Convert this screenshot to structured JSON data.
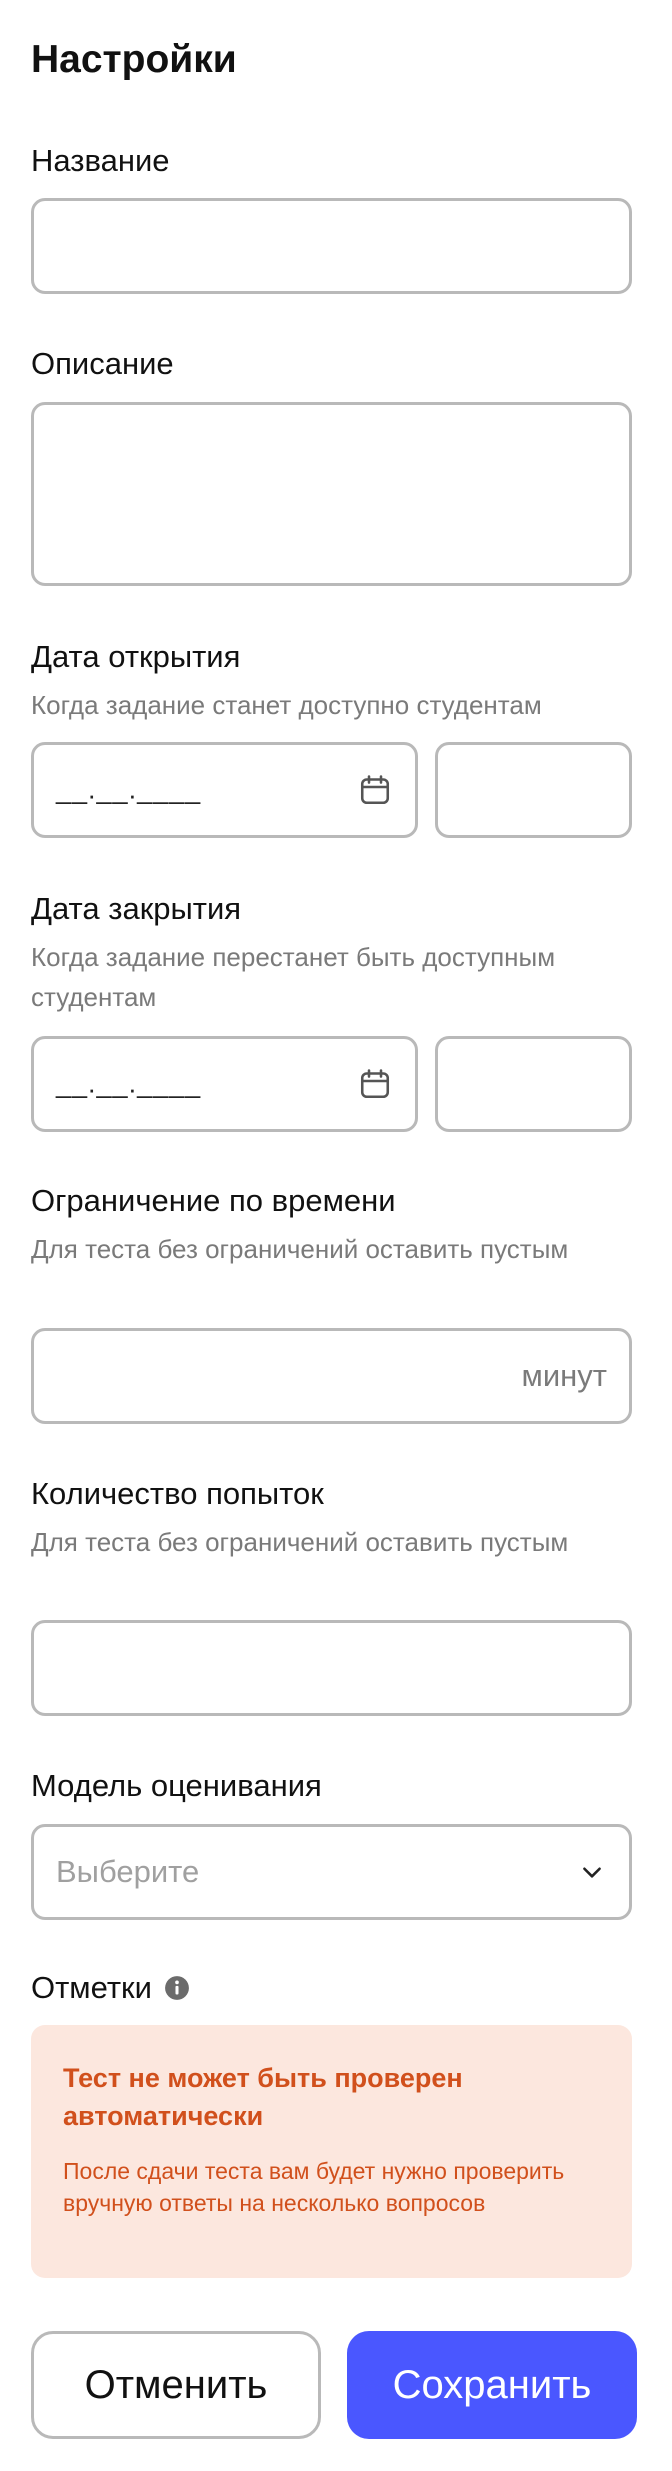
{
  "page": {
    "title": "Настройки"
  },
  "name_field": {
    "label": "Название",
    "value": "",
    "placeholder": ""
  },
  "description_field": {
    "label": "Описание",
    "value": "",
    "placeholder": ""
  },
  "open_date": {
    "label": "Дата открытия",
    "hint": "Когда задание станет доступно студентам",
    "date_mask": "__.__.____",
    "icon": "calendar-icon",
    "time_value": ""
  },
  "close_date": {
    "label": "Дата закрытия",
    "hint": "Когда задание перестанет быть доступным студентам",
    "date_mask": "__.__.____",
    "icon": "calendar-icon",
    "time_value": ""
  },
  "time_limit": {
    "label": "Ограничение по времени",
    "hint": "Для теста без ограничений оставить пустым",
    "suffix": "минут",
    "value": ""
  },
  "attempts": {
    "label": "Количество попыток",
    "hint": "Для теста без ограничений оставить пустым",
    "value": ""
  },
  "grading_model": {
    "label": "Модель оценивания",
    "placeholder": "Выберите",
    "icon": "chevron-down-icon"
  },
  "marks": {
    "label": "Отметки",
    "icon": "info-icon",
    "alert": {
      "title": "Тест не может быть проверен автоматически",
      "body": "После сдачи теста вам будет нужно проверить вручную ответы на несколько вопросов"
    }
  },
  "actions": {
    "cancel_label": "Отменить",
    "save_label": "Сохранить"
  },
  "colors": {
    "primary": "#4a57ff",
    "border": "#b9b9b9",
    "hint_text": "#7a7a7a",
    "alert_bg": "#fce7de",
    "alert_text": "#d1501c"
  }
}
